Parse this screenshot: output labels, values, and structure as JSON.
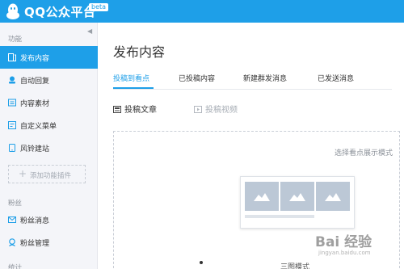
{
  "header": {
    "app_title": "QQ公众平台",
    "beta_badge": "beta",
    "brand_color": "#1e9fe8"
  },
  "sidebar": {
    "sections": [
      {
        "label": "功能",
        "items": [
          {
            "label": "发布内容",
            "icon": "publish-icon",
            "active": true
          },
          {
            "label": "自动回复",
            "icon": "autoreply-icon",
            "active": false
          },
          {
            "label": "内容素材",
            "icon": "materials-icon",
            "active": false
          },
          {
            "label": "自定义菜单",
            "icon": "custom-menu-icon",
            "active": false
          },
          {
            "label": "风铃建站",
            "icon": "site-builder-icon",
            "active": false
          }
        ],
        "add_plugin_label": "添加功能插件"
      },
      {
        "label": "粉丝",
        "items": [
          {
            "label": "粉丝消息",
            "icon": "fan-message-icon",
            "active": false
          },
          {
            "label": "粉丝管理",
            "icon": "fan-manage-icon",
            "active": false
          }
        ]
      },
      {
        "label": "统计"
      }
    ]
  },
  "main": {
    "page_title": "发布内容",
    "tabs": [
      {
        "label": "投稿到看点",
        "active": true
      },
      {
        "label": "已投稿内容",
        "active": false
      },
      {
        "label": "新建群发消息",
        "active": false
      },
      {
        "label": "已发送消息",
        "active": false
      }
    ],
    "subtabs": [
      {
        "label": "投稿文章",
        "icon": "article-icon",
        "enabled": true
      },
      {
        "label": "投稿视频",
        "icon": "video-icon",
        "enabled": false
      }
    ],
    "display_mode_hint": "选择看点展示模式",
    "mode_option_label": "三图模式"
  },
  "watermark": {
    "text": "Bai 经验",
    "url": "jingyan.baidu.com"
  }
}
